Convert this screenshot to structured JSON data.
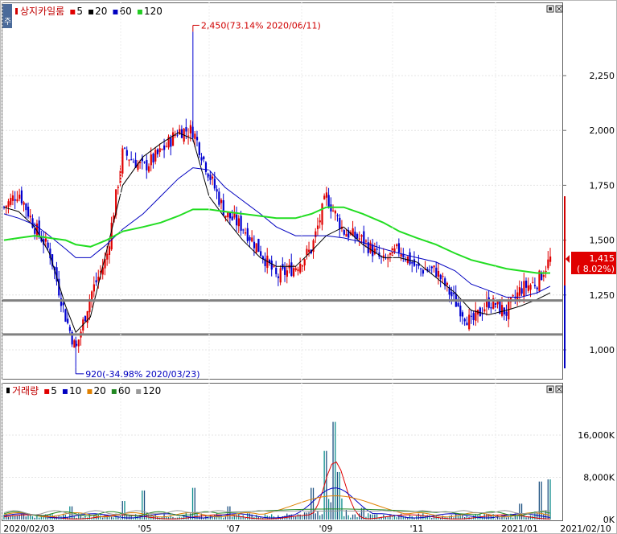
{
  "price_panel": {
    "legend": {
      "name": "상지카일룸",
      "items": [
        {
          "label": "5",
          "color": "#e00000"
        },
        {
          "label": "20",
          "color": "#000000"
        },
        {
          "label": "60",
          "color": "#0000c0"
        },
        {
          "label": "120",
          "color": "#22cc22"
        }
      ]
    },
    "high_annotation": "2,450(73.14% 2020/06/11)",
    "low_annotation": "920(-34.98% 2020/03/23)",
    "current_price": "1,415",
    "current_change": "( 8.02%)",
    "y_ticks": [
      "2,250",
      "2,000",
      "1,750",
      "1,500",
      "1,250",
      "1,000"
    ],
    "side_icon": "주"
  },
  "volume_panel": {
    "legend": {
      "name": "거래량",
      "items": [
        {
          "label": "5",
          "color": "#e00000"
        },
        {
          "label": "10",
          "color": "#0000c0"
        },
        {
          "label": "20",
          "color": "#e08000"
        },
        {
          "label": "60",
          "color": "#228822"
        },
        {
          "label": "120",
          "color": "#999999"
        }
      ]
    },
    "y_ticks": [
      "16,000K",
      "8,000K",
      "0K"
    ]
  },
  "x_ticks": [
    "2020/02/03",
    "'05",
    "'07",
    "'09",
    "'11",
    "2021/01",
    "2021/02/10"
  ],
  "chart_data": [
    {
      "type": "candlestick",
      "title": "상지카일룸",
      "period": [
        "2020/02/03",
        "2021/02/10"
      ],
      "ylim": [
        920,
        2450
      ],
      "support_lines": [
        1225,
        1070
      ],
      "high": {
        "value": 2450,
        "pct": "73.14%",
        "date": "2020/06/11"
      },
      "low": {
        "value": 920,
        "pct": "-34.98%",
        "date": "2020/03/23"
      },
      "last": {
        "value": 1415,
        "change_pct": 8.02
      },
      "close_path": [
        [
          "2020/02/03",
          1650
        ],
        [
          "2020/02/13",
          1720
        ],
        [
          "2020/02/24",
          1560
        ],
        [
          "2020/03/05",
          1450
        ],
        [
          "2020/03/16",
          1150
        ],
        [
          "2020/03/23",
          1000
        ],
        [
          "2020/04/02",
          1250
        ],
        [
          "2020/04/13",
          1420
        ],
        [
          "2020/04/24",
          1900
        ],
        [
          "2020/05/08",
          1830
        ],
        [
          "2020/05/20",
          1900
        ],
        [
          "2020/06/01",
          2000
        ],
        [
          "2020/06/11",
          2000
        ],
        [
          "2020/06/22",
          1800
        ],
        [
          "2020/07/03",
          1620
        ],
        [
          "2020/07/15",
          1560
        ],
        [
          "2020/07/27",
          1450
        ],
        [
          "2020/08/07",
          1330
        ],
        [
          "2020/08/20",
          1380
        ],
        [
          "2020/08/31",
          1460
        ],
        [
          "2020/09/10",
          1700
        ],
        [
          "2020/09/22",
          1540
        ],
        [
          "2020/10/05",
          1500
        ],
        [
          "2020/10/19",
          1400
        ],
        [
          "2020/10/30",
          1460
        ],
        [
          "2020/11/11",
          1370
        ],
        [
          "2020/11/24",
          1360
        ],
        [
          "2020/12/07",
          1220
        ],
        [
          "2020/12/18",
          1120
        ],
        [
          "2020/12/30",
          1220
        ],
        [
          "2021/01/11",
          1170
        ],
        [
          "2021/01/21",
          1280
        ],
        [
          "2021/02/01",
          1310
        ],
        [
          "2021/02/10",
          1415
        ]
      ],
      "ma": [
        {
          "name": "20",
          "values": [
            1650,
            1630,
            1560,
            1440,
            1200,
            1080,
            1150,
            1450,
            1750,
            1880,
            1940,
            1990,
            1960,
            1700,
            1600,
            1500,
            1420,
            1380,
            1380,
            1450,
            1520,
            1560,
            1480,
            1420,
            1420,
            1400,
            1330,
            1260,
            1180,
            1160,
            1180,
            1200,
            1230,
            1260
          ]
        },
        {
          "name": "60",
          "values": [
            1620,
            1600,
            1570,
            1520,
            1460,
            1420,
            1420,
            1480,
            1550,
            1620,
            1700,
            1780,
            1830,
            1820,
            1740,
            1680,
            1620,
            1560,
            1520,
            1520,
            1520,
            1510,
            1490,
            1460,
            1440,
            1420,
            1400,
            1360,
            1300,
            1270,
            1240,
            1240,
            1260,
            1290
          ]
        },
        {
          "name": "120",
          "values": [
            1500,
            1510,
            1520,
            1510,
            1500,
            1480,
            1470,
            1500,
            1540,
            1560,
            1580,
            1610,
            1640,
            1640,
            1630,
            1620,
            1610,
            1600,
            1600,
            1620,
            1650,
            1650,
            1620,
            1580,
            1540,
            1510,
            1480,
            1440,
            1410,
            1390,
            1370,
            1360,
            1350,
            1350
          ]
        }
      ]
    },
    {
      "type": "bar",
      "title": "거래량",
      "unit": "K",
      "ylim": [
        0,
        20000
      ],
      "spikes": [
        [
          "2020/02/03",
          900
        ],
        [
          "2020/03/20",
          2500
        ],
        [
          "2020/04/24",
          3500
        ],
        [
          "2020/05/08",
          5500
        ],
        [
          "2020/06/11",
          6000
        ],
        [
          "2020/07/06",
          2500
        ],
        [
          "2020/08/31",
          6000
        ],
        [
          "2020/09/10",
          13000
        ],
        [
          "2020/09/15",
          18500
        ],
        [
          "2020/09/18",
          9000
        ],
        [
          "2020/10/05",
          2200
        ],
        [
          "2021/01/21",
          3000
        ],
        [
          "2021/02/03",
          7200
        ],
        [
          "2021/02/10",
          7600
        ]
      ],
      "ma": [
        {
          "name": "5",
          "peak": 11000
        },
        {
          "name": "10",
          "peak": 6000
        },
        {
          "name": "20",
          "peak": 4500
        },
        {
          "name": "60",
          "peak": 2000
        },
        {
          "name": "120",
          "peak": 1600
        }
      ]
    }
  ]
}
